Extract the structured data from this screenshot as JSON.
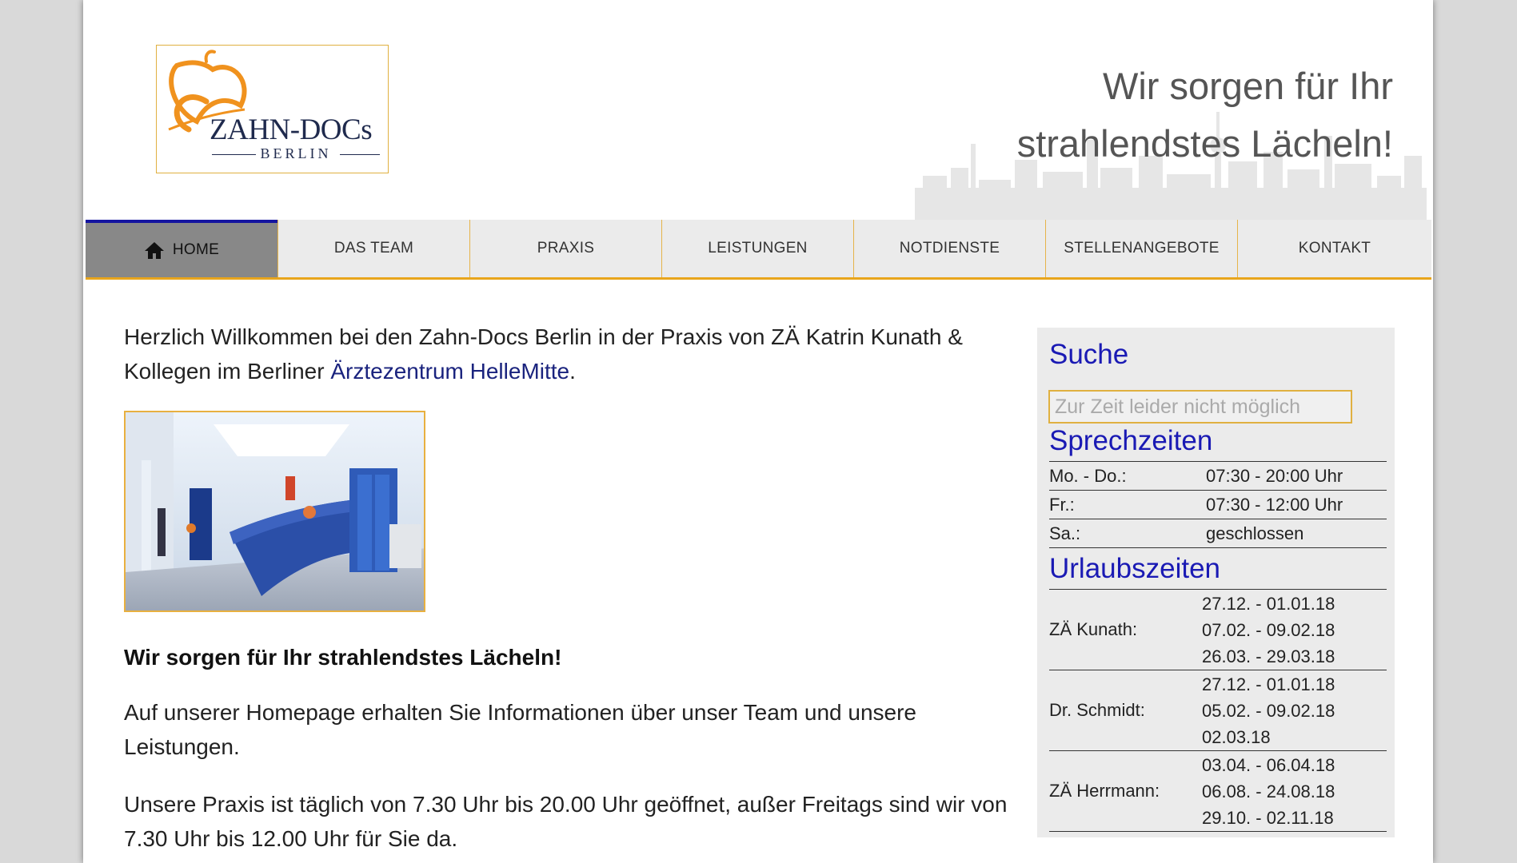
{
  "logo": {
    "title": "ZAHN-DOCs",
    "subtitle": "BERLIN"
  },
  "header": {
    "tagline_line1": "Wir sorgen für Ihr",
    "tagline_line2": "strahlendstes Lächeln!"
  },
  "nav": {
    "items": [
      {
        "label": "HOME",
        "icon": "home-icon",
        "active": true
      },
      {
        "label": "DAS TEAM"
      },
      {
        "label": "PRAXIS"
      },
      {
        "label": "LEISTUNGEN"
      },
      {
        "label": "NOTDIENSTE"
      },
      {
        "label": "STELLENANGEBOTE"
      },
      {
        "label": "KONTAKT"
      }
    ]
  },
  "main": {
    "intro_part1": "Herzlich Willkommen bei den Zahn-Docs Berlin in der Praxis von ZÄ Katrin Kunath & Kollegen im Berliner ",
    "intro_link": "Ärztezentrum HelleMitte",
    "intro_part2": ".",
    "headline": "Wir sorgen für Ihr strahlendstes Lächeln!",
    "para1": "Auf unserer Homepage erhalten Sie Informationen über unser Team und unsere Leistungen.",
    "para2": "Unsere Praxis ist täglich von 7.30 Uhr bis 20.00 Uhr geöffnet, außer Freitags sind wir von 7.30 Uhr bis 12.00 Uhr für Sie da."
  },
  "sidebar": {
    "search_heading": "Suche",
    "search_placeholder": "Zur Zeit leider nicht möglich",
    "hours_heading": "Sprechzeiten",
    "hours": [
      {
        "day": "Mo. - Do.:",
        "time": "07:30 - 20:00 Uhr"
      },
      {
        "day": "Fr.:",
        "time": "07:30 - 12:00 Uhr"
      },
      {
        "day": "Sa.:",
        "time": "geschlossen"
      }
    ],
    "vacation_heading": "Urlaubszeiten",
    "vacations": [
      {
        "name": "ZÄ Kunath:",
        "dates": [
          "27.12. - 01.01.18",
          "07.02. - 09.02.18",
          "26.03. - 29.03.18"
        ]
      },
      {
        "name": "Dr. Schmidt:",
        "dates": [
          "27.12. - 01.01.18",
          "05.02. - 09.02.18",
          "02.03.18"
        ]
      },
      {
        "name": "ZÄ Herrmann:",
        "dates": [
          "03.04. - 06.04.18",
          "06.08. - 24.08.18",
          "29.10. - 02.11.18"
        ]
      }
    ]
  },
  "colors": {
    "accent": "#e8a51c",
    "nav_active": "#888888",
    "heading_blue": "#1a1ab4",
    "link": "#1a237e",
    "logo_orange": "#f0921e",
    "logo_navy": "#1f2a4d"
  }
}
